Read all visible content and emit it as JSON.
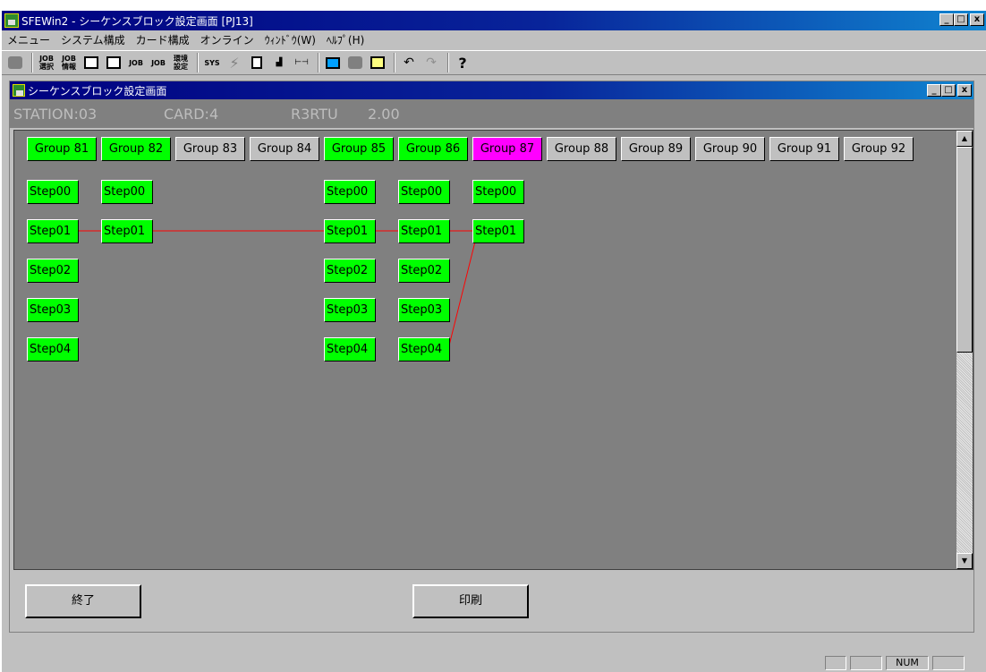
{
  "app": {
    "title": "SFEWin2 - シーケンスブロック設定画面 [PJ13]",
    "window_controls": [
      "_",
      "□",
      "x"
    ]
  },
  "menu": [
    "メニュー",
    "システム構成",
    "カード構成",
    "オンライン",
    "ｳｨﾝﾄﾞｳ(W)",
    "ﾍﾙﾌﾟ(H)"
  ],
  "toolbar": {
    "icons": [
      "stop-icon",
      "job-select-icon",
      "job-info-icon",
      "grid-icon",
      "list-icon",
      "job-1-icon",
      "job-2-icon",
      "env-settings-icon",
      "sys-icon",
      "lightning-icon",
      "document-icon",
      "step-icon",
      "hoh-icon",
      "monitor-icon",
      "stop-2-icon",
      "card-icon",
      "undo-icon",
      "redo-icon",
      "help-icon"
    ],
    "labels": {
      "job_select": "JOB\n選択",
      "job_info": "JOB\n情報",
      "job1": "JOB",
      "job2": "JOB",
      "env": "環境\n設定",
      "sys": "SYS"
    }
  },
  "child_window": {
    "title": "シーケンスブロック設定画面",
    "station": "STATION:03",
    "card": "CARD:4",
    "model": "R3RTU",
    "version": "2.00"
  },
  "groups": [
    {
      "label": "Group 81",
      "state": "on"
    },
    {
      "label": "Group 82",
      "state": "on"
    },
    {
      "label": "Group 83",
      "state": "off"
    },
    {
      "label": "Group 84",
      "state": "off"
    },
    {
      "label": "Group 85",
      "state": "on"
    },
    {
      "label": "Group 86",
      "state": "on"
    },
    {
      "label": "Group 87",
      "state": "selected"
    },
    {
      "label": "Group 88",
      "state": "off"
    },
    {
      "label": "Group 89",
      "state": "off"
    },
    {
      "label": "Group 90",
      "state": "off"
    },
    {
      "label": "Group 91",
      "state": "off"
    },
    {
      "label": "Group 92",
      "state": "off"
    }
  ],
  "steps": [
    {
      "group": 0,
      "labels": [
        "Step00",
        "Step01",
        "Step02",
        "Step03",
        "Step04"
      ]
    },
    {
      "group": 1,
      "labels": [
        "Step00",
        "Step01"
      ]
    },
    {
      "group": 4,
      "labels": [
        "Step00",
        "Step01",
        "Step02",
        "Step03",
        "Step04"
      ]
    },
    {
      "group": 5,
      "labels": [
        "Step00",
        "Step01",
        "Step02",
        "Step03",
        "Step04"
      ]
    },
    {
      "group": 6,
      "labels": [
        "Step00",
        "Step01"
      ]
    }
  ],
  "connections": [
    {
      "from": [
        0,
        1
      ],
      "to": [
        6,
        1
      ]
    },
    {
      "from": [
        5,
        4
      ],
      "to": [
        6,
        1
      ]
    }
  ],
  "colors": {
    "group_on": "#00ff00",
    "group_selected": "#ff00ff",
    "group_off": "#c0c0c0",
    "connection": "#ff0000",
    "canvas": "#808080"
  },
  "buttons": {
    "exit": "終了",
    "print": "印刷"
  },
  "status": {
    "num": "NUM"
  }
}
